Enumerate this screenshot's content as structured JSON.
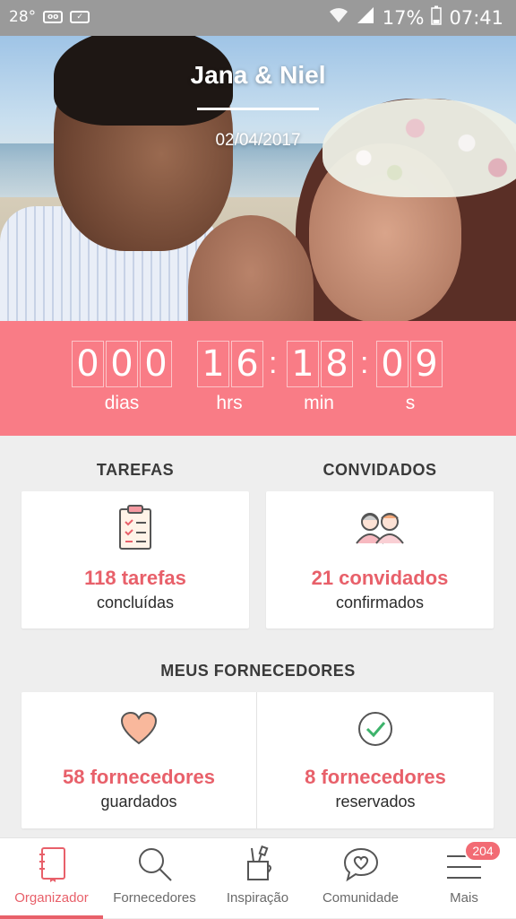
{
  "status_bar": {
    "temperature": "28°",
    "battery_percent": "17%",
    "time": "07:41"
  },
  "hero": {
    "couple_names": "Jana & Niel",
    "wedding_date": "02/04/2017"
  },
  "countdown": {
    "days": [
      "0",
      "0",
      "0"
    ],
    "hours": [
      "1",
      "6"
    ],
    "minutes": [
      "1",
      "8"
    ],
    "seconds": [
      "0",
      "9"
    ],
    "separator": ":",
    "labels": {
      "days": "dias",
      "hours": "hrs",
      "minutes": "min",
      "seconds": "s"
    }
  },
  "tasks": {
    "title": "TAREFAS",
    "count_text": "118 tarefas",
    "sub_text": "concluídas",
    "icon": "clipboard-checklist-icon"
  },
  "guests": {
    "title": "CONVIDADOS",
    "count_text": "21 convidados",
    "sub_text": "confirmados",
    "icon": "guests-couple-icon"
  },
  "vendors": {
    "title": "MEUS FORNECEDORES",
    "saved": {
      "count_text": "58 fornecedores",
      "sub_text": "guardados",
      "icon": "heart-icon"
    },
    "booked": {
      "count_text": "8 fornecedores",
      "sub_text": "reservados",
      "icon": "check-circle-icon"
    }
  },
  "bottom_nav": {
    "items": [
      {
        "label": "Organizador",
        "icon": "notebook-icon",
        "active": true
      },
      {
        "label": "Fornecedores",
        "icon": "search-icon",
        "active": false
      },
      {
        "label": "Inspiração",
        "icon": "brush-cup-icon",
        "active": false
      },
      {
        "label": "Comunidade",
        "icon": "chat-heart-icon",
        "active": false
      },
      {
        "label": "Mais",
        "icon": "menu-icon",
        "active": false
      }
    ],
    "more_badge": "204"
  },
  "colors": {
    "accent": "#f97c86",
    "accent_text": "#e8606a",
    "background": "#eeeeee"
  }
}
